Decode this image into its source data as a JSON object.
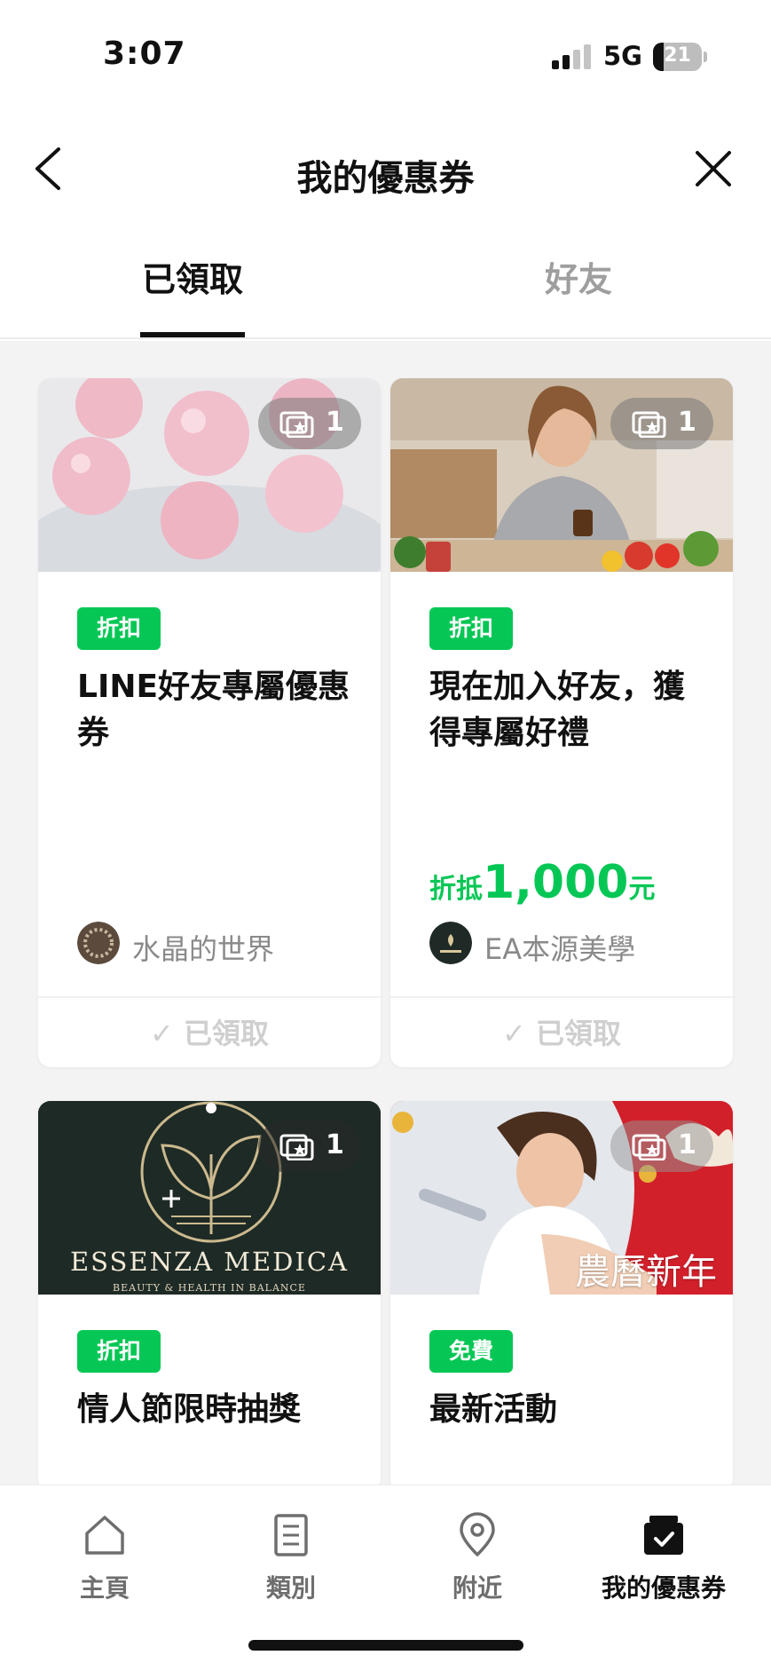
{
  "status_bar": {
    "time": "3:07",
    "network": "5G",
    "battery": "21"
  },
  "header": {
    "title": "我的優惠券"
  },
  "tabs": [
    {
      "label": "已領取",
      "active": true
    },
    {
      "label": "好友",
      "active": false
    }
  ],
  "coupons": [
    {
      "quantity": "1",
      "tag": "折扣",
      "title": "LINE好友專屬優惠券",
      "shop": "水晶的世界",
      "status": "已領取"
    },
    {
      "quantity": "1",
      "tag": "折扣",
      "title": "現在加入好友，獲得專屬好禮",
      "discount_prefix": "折抵",
      "discount_amount": "1,000",
      "discount_suffix": "元",
      "shop": "EA本源美學",
      "status": "已領取"
    },
    {
      "quantity": "1",
      "tag": "折扣",
      "title": "情人節限時抽獎",
      "image_text": "ESSENZA MEDICA",
      "image_subtext": "BEAUTY & HEALTH IN BALANCE"
    },
    {
      "quantity": "1",
      "tag": "免費",
      "title": "最新活動",
      "image_text": "農曆新年"
    }
  ],
  "bottom_nav": [
    {
      "label": "主頁",
      "icon": "home-icon"
    },
    {
      "label": "類別",
      "icon": "list-icon"
    },
    {
      "label": "附近",
      "icon": "location-pin-icon"
    },
    {
      "label": "我的優惠券",
      "icon": "coupon-box-icon",
      "active": true
    }
  ],
  "colors": {
    "accent_green": "#06c755",
    "inactive_gray": "#9e9e9e",
    "background": "#f3f3f3"
  }
}
